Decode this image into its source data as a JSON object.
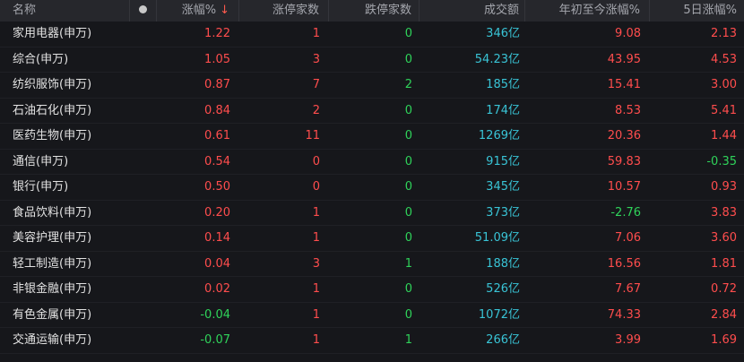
{
  "header": {
    "name": "名称",
    "change_pct": "涨幅%",
    "sort_arrow": "↓",
    "limit_up": "涨停家数",
    "limit_down": "跌停家数",
    "volume": "成交额",
    "ytd": "年初至今涨幅%",
    "d5": "5日涨幅%"
  },
  "rows": [
    {
      "name": "家用电器(申万)",
      "chg": "1.22",
      "up": "1",
      "down": "0",
      "vol": "346亿",
      "ytd": "9.08",
      "d5": "2.13"
    },
    {
      "name": "综合(申万)",
      "chg": "1.05",
      "up": "3",
      "down": "0",
      "vol": "54.23亿",
      "ytd": "43.95",
      "d5": "4.53"
    },
    {
      "name": "纺织服饰(申万)",
      "chg": "0.87",
      "up": "7",
      "down": "2",
      "vol": "185亿",
      "ytd": "15.41",
      "d5": "3.00"
    },
    {
      "name": "石油石化(申万)",
      "chg": "0.84",
      "up": "2",
      "down": "0",
      "vol": "174亿",
      "ytd": "8.53",
      "d5": "5.41"
    },
    {
      "name": "医药生物(申万)",
      "chg": "0.61",
      "up": "11",
      "down": "0",
      "vol": "1269亿",
      "ytd": "20.36",
      "d5": "1.44"
    },
    {
      "name": "通信(申万)",
      "chg": "0.54",
      "up": "0",
      "down": "0",
      "vol": "915亿",
      "ytd": "59.83",
      "d5": "-0.35"
    },
    {
      "name": "银行(申万)",
      "chg": "0.50",
      "up": "0",
      "down": "0",
      "vol": "345亿",
      "ytd": "10.57",
      "d5": "0.93"
    },
    {
      "name": "食品饮料(申万)",
      "chg": "0.20",
      "up": "1",
      "down": "0",
      "vol": "373亿",
      "ytd": "-2.76",
      "d5": "3.83"
    },
    {
      "name": "美容护理(申万)",
      "chg": "0.14",
      "up": "1",
      "down": "0",
      "vol": "51.09亿",
      "ytd": "7.06",
      "d5": "3.60"
    },
    {
      "name": "轻工制造(申万)",
      "chg": "0.04",
      "up": "3",
      "down": "1",
      "vol": "188亿",
      "ytd": "16.56",
      "d5": "1.81"
    },
    {
      "name": "非银金融(申万)",
      "chg": "0.02",
      "up": "1",
      "down": "0",
      "vol": "526亿",
      "ytd": "7.67",
      "d5": "0.72"
    },
    {
      "name": "有色金属(申万)",
      "chg": "-0.04",
      "up": "1",
      "down": "0",
      "vol": "1072亿",
      "ytd": "74.33",
      "d5": "2.84"
    },
    {
      "name": "交通运输(申万)",
      "chg": "-0.07",
      "up": "1",
      "down": "1",
      "vol": "266亿",
      "ytd": "3.99",
      "d5": "1.69"
    }
  ],
  "colors": {
    "up": "#ff4d4d",
    "down": "#2fd35a",
    "volume": "#39c4d6",
    "background": "#16171b",
    "header_bg": "#26272c"
  }
}
